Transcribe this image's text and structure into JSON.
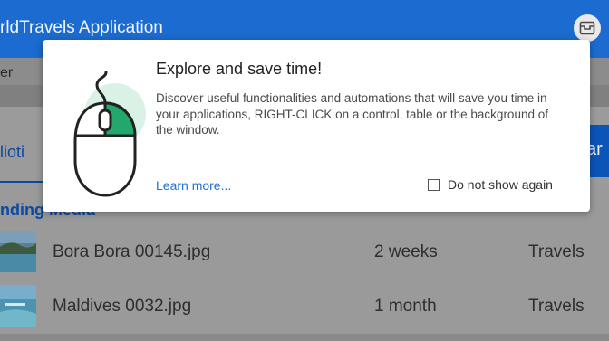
{
  "app": {
    "title_fragment": "rldTravels Application",
    "menu_fragment": "er",
    "library_tab_fragment": "lioti",
    "right_button_fragment": "ar",
    "section_heading_fragment": "nding Media"
  },
  "media_rows": [
    {
      "name": "Bora Bora 00145.jpg",
      "age": "2 weeks",
      "category": "Travels"
    },
    {
      "name": "Maldives 0032.jpg",
      "age": "1 month",
      "category": "Travels"
    }
  ],
  "popup": {
    "heading": "Explore and save time!",
    "description": "Discover useful functionalities and automations that will save you time in your applications, RIGHT-CLICK on a control, table or the background of the window.",
    "learn_more": "Learn more...",
    "do_not_show_again": "Do not show again",
    "do_not_show_checked": false
  },
  "colors": {
    "titlebar": "#1b6bd0",
    "accent_blue": "#0b4aa2",
    "link_blue": "#1c6fd6",
    "mouse_green": "#22a86a"
  },
  "icons": {
    "title_button": "archive-box-icon",
    "illustration": "computer-mouse-icon"
  }
}
